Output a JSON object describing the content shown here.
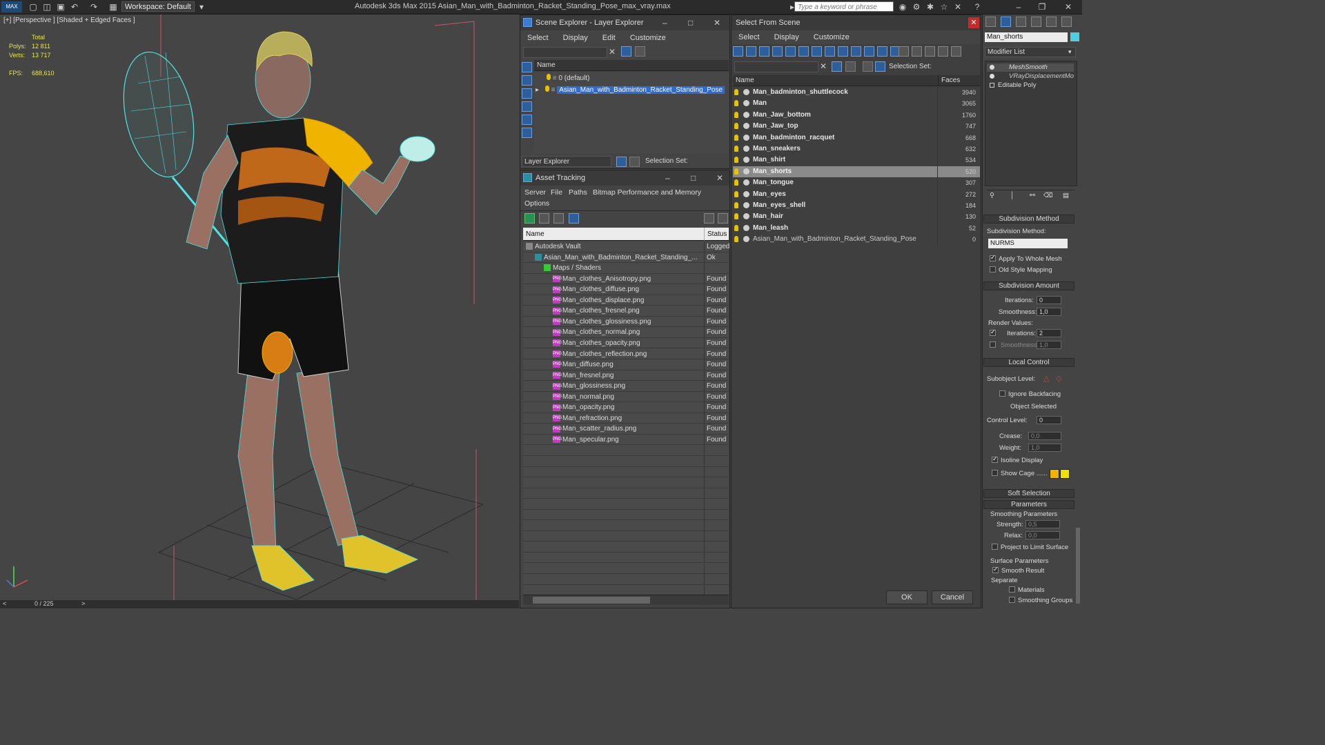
{
  "titlebar": {
    "logo": "MAX",
    "workspace_label": "Workspace: Default",
    "app_title": "Autodesk 3ds Max  2015     Asian_Man_with_Badminton_Racket_Standing_Pose_max_vray.max",
    "search_placeholder": "Type a keyword or phrase"
  },
  "viewport": {
    "label": "[+] [Perspective ] [Shaded + Edged Faces ]",
    "stats": {
      "total_label": "Total",
      "polys_label": "Polys:",
      "polys_value": "12 811",
      "verts_label": "Verts:",
      "verts_value": "13 717",
      "fps_label": "FPS:",
      "fps_value": "688,610"
    },
    "timeline_value": "0 / 225"
  },
  "scene_explorer": {
    "title": "Scene Explorer - Layer Explorer",
    "menu": [
      "Select",
      "Display",
      "Edit",
      "Customize"
    ],
    "column_name": "Name",
    "layers": [
      "0 (default)",
      "Asian_Man_with_Badminton_Racket_Standing_Pose"
    ],
    "footer_dropdown": "Layer Explorer",
    "selection_set_label": "Selection Set:"
  },
  "asset_tracking": {
    "title": "Asset Tracking",
    "menu": [
      "Server",
      "File",
      "Paths",
      "Bitmap Performance and Memory",
      "Options"
    ],
    "col_name": "Name",
    "col_status": "Status",
    "rows": [
      {
        "name": "Autodesk Vault",
        "status": "Logged",
        "indent": 0
      },
      {
        "name": "Asian_Man_with_Badminton_Racket_Standing_...",
        "status": "Ok",
        "indent": 1
      },
      {
        "name": "Maps / Shaders",
        "status": "",
        "indent": 2
      },
      {
        "name": "Man_clothes_Anisotropy.png",
        "status": "Found",
        "indent": 3
      },
      {
        "name": "Man_clothes_diffuse.png",
        "status": "Found",
        "indent": 3
      },
      {
        "name": "Man_clothes_displace.png",
        "status": "Found",
        "indent": 3
      },
      {
        "name": "Man_clothes_fresnel.png",
        "status": "Found",
        "indent": 3
      },
      {
        "name": "Man_clothes_glossiness.png",
        "status": "Found",
        "indent": 3
      },
      {
        "name": "Man_clothes_normal.png",
        "status": "Found",
        "indent": 3
      },
      {
        "name": "Man_clothes_opacity.png",
        "status": "Found",
        "indent": 3
      },
      {
        "name": "Man_clothes_reflection.png",
        "status": "Found",
        "indent": 3
      },
      {
        "name": "Man_diffuse.png",
        "status": "Found",
        "indent": 3
      },
      {
        "name": "Man_fresnel.png",
        "status": "Found",
        "indent": 3
      },
      {
        "name": "Man_glossiness.png",
        "status": "Found",
        "indent": 3
      },
      {
        "name": "Man_normal.png",
        "status": "Found",
        "indent": 3
      },
      {
        "name": "Man_opacity.png",
        "status": "Found",
        "indent": 3
      },
      {
        "name": "Man_refraction.png",
        "status": "Found",
        "indent": 3
      },
      {
        "name": "Man_scatter_radius.png",
        "status": "Found",
        "indent": 3
      },
      {
        "name": "Man_specular.png",
        "status": "Found",
        "indent": 3
      }
    ]
  },
  "select_from_scene": {
    "title": "Select From Scene",
    "menu": [
      "Select",
      "Display",
      "Customize"
    ],
    "selection_set_label": "Selection Set:",
    "col_name": "Name",
    "col_faces": "Faces",
    "objects": [
      {
        "name": "Man_badminton_shuttlecock",
        "faces": "3940"
      },
      {
        "name": "Man",
        "faces": "3065"
      },
      {
        "name": "Man_Jaw_bottom",
        "faces": "1760"
      },
      {
        "name": "Man_Jaw_top",
        "faces": "747"
      },
      {
        "name": "Man_badminton_racquet",
        "faces": "668"
      },
      {
        "name": "Man_sneakers",
        "faces": "632"
      },
      {
        "name": "Man_shirt",
        "faces": "534"
      },
      {
        "name": "Man_shorts",
        "faces": "520"
      },
      {
        "name": "Man_tongue",
        "faces": "307"
      },
      {
        "name": "Man_eyes",
        "faces": "272"
      },
      {
        "name": "Man_eyes_shell",
        "faces": "184"
      },
      {
        "name": "Man_hair",
        "faces": "130"
      },
      {
        "name": "Man_leash",
        "faces": "52"
      },
      {
        "name": "Asian_Man_with_Badminton_Racket_Standing_Pose",
        "faces": "0"
      }
    ],
    "selected_index": 7,
    "ok_label": "OK",
    "cancel_label": "Cancel"
  },
  "command_panel": {
    "object_name": "Man_shorts",
    "modifier_list_label": "Modifier List",
    "stack": [
      "MeshSmooth",
      "VRayDisplacementMod",
      "Editable Poly"
    ],
    "subdivision_method_title": "Subdivision Method",
    "subdivision_method_label": "Subdivision Method:",
    "subdivision_method_value": "NURMS",
    "apply_whole_mesh": "Apply To Whole Mesh",
    "old_style_mapping": "Old Style Mapping",
    "subdivision_amount_title": "Subdivision Amount",
    "iterations_label": "Iterations:",
    "iterations_value": "0",
    "smoothness_label": "Smoothness:",
    "smoothness_value": "1,0",
    "render_values_label": "Render Values:",
    "render_iterations_label": "Iterations:",
    "render_iterations_value": "2",
    "render_smoothness_label": "Smoothness:",
    "render_smoothness_value": "1,0",
    "local_control_title": "Local Control",
    "subobject_level_label": "Subobject Level:",
    "ignore_backfacing": "Ignore Backfacing",
    "object_selected": "Object Selected",
    "control_level_label": "Control Level:",
    "control_level_value": "0",
    "crease_label": "Crease:",
    "crease_value": "0,0",
    "weight_label": "Weight:",
    "weight_value": "1,0",
    "isoline_display": "Isoline Display",
    "show_cage": "Show Cage ......",
    "soft_selection_title": "Soft Selection",
    "parameters_title": "Parameters",
    "smoothing_parameters_label": "Smoothing Parameters",
    "strength_label": "Strength:",
    "strength_value": "0,5",
    "relax_label": "Relax:",
    "relax_value": "0,0",
    "project_limit_surface": "Project to Limit Surface",
    "surface_parameters_label": "Surface Parameters",
    "smooth_result": "Smooth Result",
    "separate_label": "Separate",
    "materials_label": "Materials",
    "smoothing_groups_label": "Smoothing Groups"
  },
  "colors": {
    "selection_blue": "#2f6bd1",
    "wire_cyan": "#4fe3e3",
    "accent_yellow": "#f0b400"
  }
}
